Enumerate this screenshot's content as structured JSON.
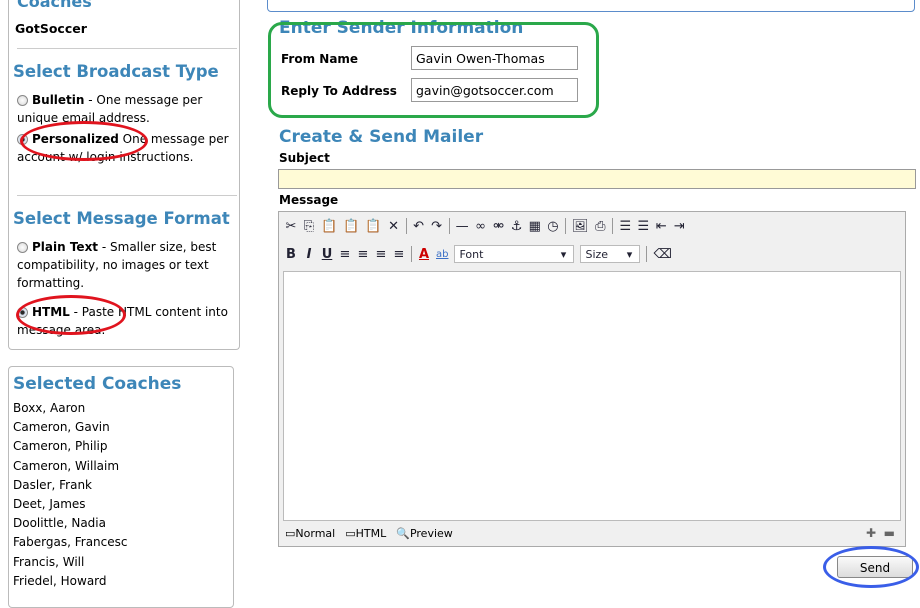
{
  "left": {
    "coaches_heading_partial": "Coaches",
    "club": "GotSoccer",
    "broadcast_heading": "Select Broadcast Type",
    "bulletin_label": "Bulletin",
    "bulletin_desc": " - One message per unique email address.",
    "personalized_label": "Personalized",
    "personalized_desc": " One message per account w/ login instructions.",
    "format_heading": "Select Message Format",
    "plain_label": "Plain Text",
    "plain_desc": " - Smaller size, best compatibility, no images or text formatting.",
    "html_label": "HTML",
    "html_desc": " - Paste HTML content into message area.",
    "selected_heading": "Selected Coaches",
    "coaches": [
      "Boxx, Aaron",
      "Cameron, Gavin",
      "Cameron, Philip",
      "Cameron, Willaim",
      "Dasler, Frank",
      "Deet, James",
      "Doolittle, Nadia",
      "Fabergas, Francesc",
      "Francis, Will",
      "Friedel, Howard"
    ]
  },
  "sender": {
    "heading": "Enter Sender Information",
    "from_label": "From Name",
    "from_value": "Gavin Owen-Thomas",
    "reply_label": "Reply To Address",
    "reply_value": "gavin@gotsoccer.com"
  },
  "mailer": {
    "heading": "Create & Send Mailer",
    "subject_label": "Subject",
    "subject_value": "",
    "message_label": "Message",
    "font_select": "Font",
    "size_select": "Size",
    "modes": [
      "Normal",
      "HTML",
      "Preview"
    ],
    "send_label": "Send"
  },
  "colors": {
    "heading_blue": "#3d86b8",
    "green_ring": "#2aa84a",
    "red_ring": "#e0141e",
    "blue_ring": "#3a5ee8",
    "subject_bg": "#fffbd6"
  }
}
